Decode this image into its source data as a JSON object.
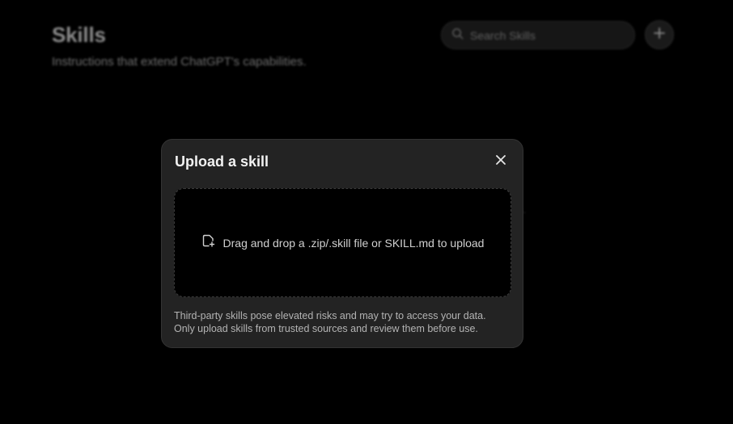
{
  "page": {
    "title": "Skills",
    "subtitle": "Instructions that extend ChatGPT's capabilities.",
    "search": {
      "placeholder": "Search Skills",
      "icon": "search-icon"
    },
    "add_button": {
      "icon": "plus-icon"
    },
    "partial_text": "s."
  },
  "modal": {
    "title": "Upload a skill",
    "close_icon": "close-icon",
    "dropzone": {
      "icon": "file-plus-icon",
      "text": "Drag and drop a .zip/.skill file or SKILL.md to upload"
    },
    "warning": {
      "line1": "Third-party skills pose elevated risks and may try to access your data.",
      "line2": "Only upload skills from trusted sources and review them before use."
    }
  },
  "colors": {
    "background": "#000000",
    "modal_background": "#232323",
    "dropzone_background": "#000000",
    "text_primary": "#f2f2f2"
  }
}
